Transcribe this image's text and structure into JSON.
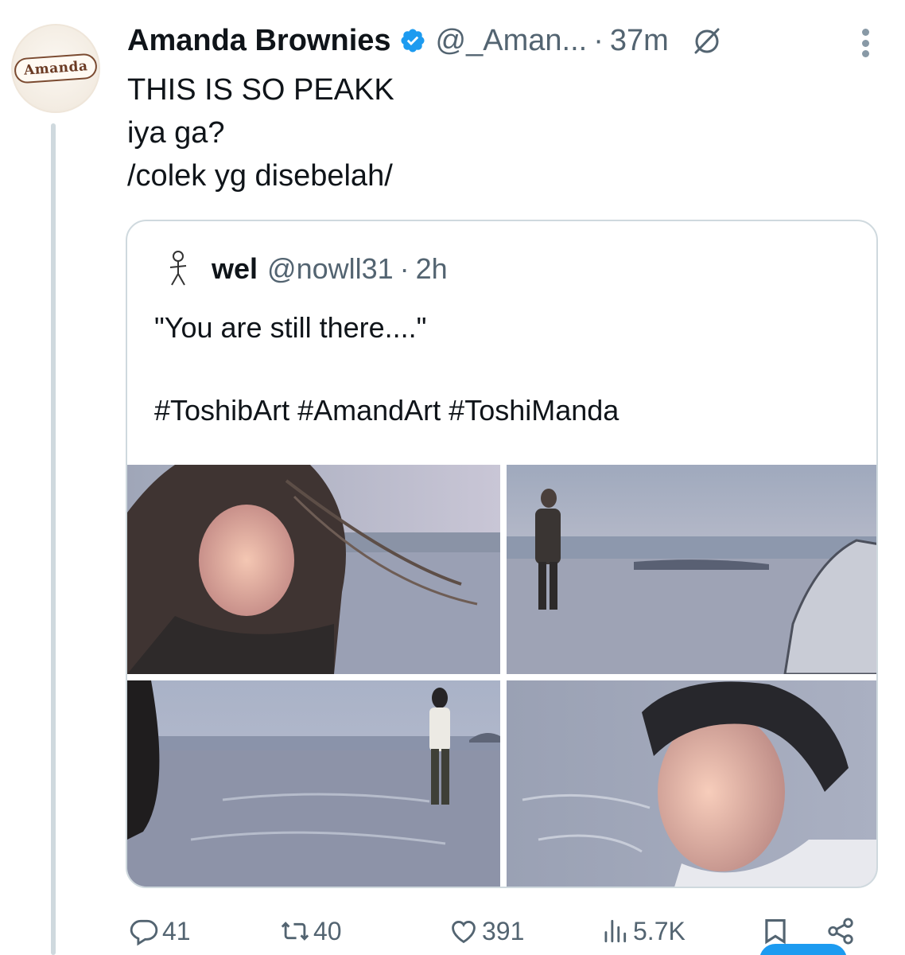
{
  "tweet": {
    "display_name": "Amanda Brownies",
    "avatar_logo_text": "Amanda",
    "handle": "@_Aman...",
    "separator": "·",
    "time": "37m",
    "text_lines": [
      "THIS IS SO PEAKK",
      "iya ga?",
      "/colek yg disebelah/"
    ],
    "icons": {
      "verified": "verified-badge-icon",
      "grok": "grok-icon",
      "more": "more-dots-icon"
    },
    "colors": {
      "verified": "#1d9bf0",
      "secondary_text": "#536471",
      "border": "#cfd9de"
    }
  },
  "quote": {
    "display_name": "wel",
    "handle": "@nowll31",
    "separator": "·",
    "time": "2h",
    "text_lines": [
      "\"You are still there....\"",
      "",
      "#ToshibArt #AmandArt #ToshiManda"
    ],
    "media": [
      {
        "name": "media-girl-hair-closeup"
      },
      {
        "name": "media-girl-on-beach"
      },
      {
        "name": "media-man-on-beach"
      },
      {
        "name": "media-man-closeup"
      }
    ]
  },
  "actions": {
    "replies": "41",
    "retweets": "40",
    "likes": "391",
    "views": "5.7K",
    "icons": [
      "reply-icon",
      "retweet-icon",
      "like-icon",
      "views-icon",
      "bookmark-icon",
      "share-icon"
    ]
  }
}
